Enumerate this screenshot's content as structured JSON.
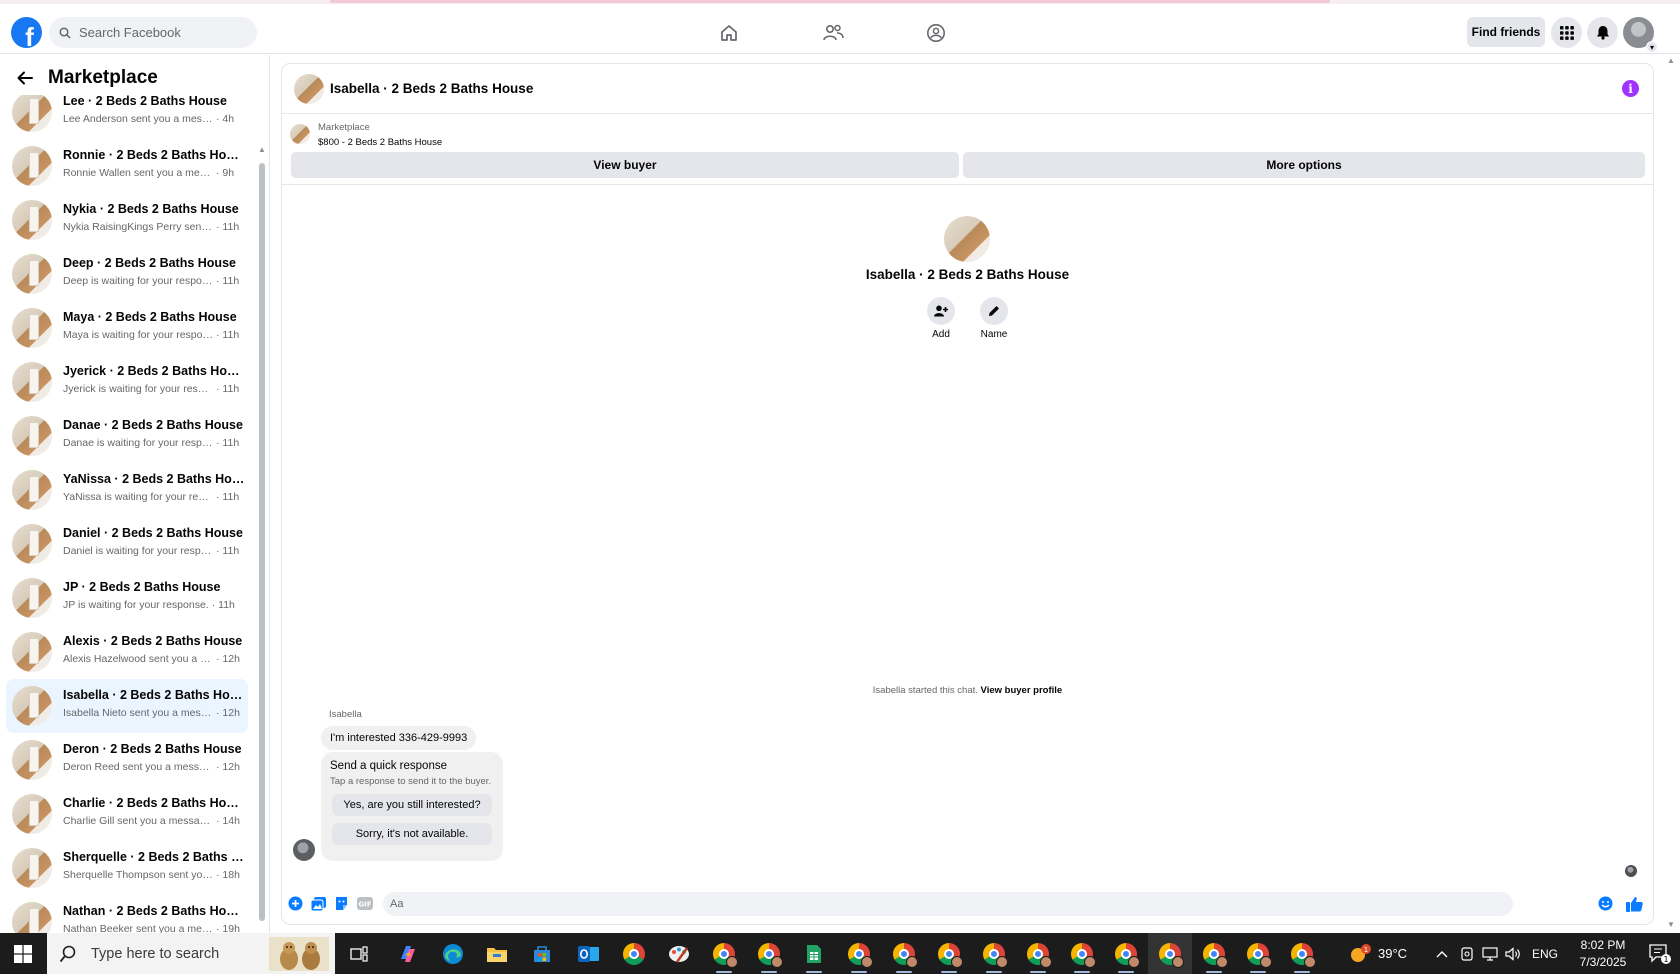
{
  "header": {
    "logo_letter": "f",
    "search_placeholder": "Search Facebook",
    "find_friends_label": "Find friends",
    "nav_icons": [
      "home-icon",
      "friends-icon",
      "groups-icon"
    ]
  },
  "sidebar": {
    "title": "Marketplace",
    "conversations": [
      {
        "name": "Lee · 2 Beds 2 Baths House",
        "preview": "Lee Anderson sent you a message ...",
        "time": "· 4h",
        "active": false
      },
      {
        "name": "Ronnie · 2 Beds 2 Baths House",
        "preview": "Ronnie Wallen sent you a message...",
        "time": "· 9h",
        "active": false
      },
      {
        "name": "Nykia · 2 Beds 2 Baths House",
        "preview": "Nykia RaisingKings Perry sent yo...",
        "time": "· 11h",
        "active": false
      },
      {
        "name": "Deep · 2 Beds 2 Baths House",
        "preview": "Deep is waiting for your response.",
        "time": "· 11h",
        "active": false
      },
      {
        "name": "Maya · 2 Beds 2 Baths House",
        "preview": "Maya is waiting for your response.",
        "time": "· 11h",
        "active": false
      },
      {
        "name": "Jyerick · 2 Beds 2 Baths House",
        "preview": "Jyerick is waiting for your respon...",
        "time": "· 11h",
        "active": false
      },
      {
        "name": "Danae · 2 Beds 2 Baths House",
        "preview": "Danae is waiting for your respon...",
        "time": "· 11h",
        "active": false
      },
      {
        "name": "YaNissa · 2 Beds 2 Baths House",
        "preview": "YaNissa is waiting for your respo...",
        "time": "· 11h",
        "active": false
      },
      {
        "name": "Daniel · 2 Beds 2 Baths House",
        "preview": "Daniel is waiting for your respon...",
        "time": "· 11h",
        "active": false
      },
      {
        "name": "JP · 2 Beds 2 Baths House",
        "preview": "JP is waiting for your response.",
        "time": "· 11h",
        "active": false
      },
      {
        "name": "Alexis · 2 Beds 2 Baths House",
        "preview": "Alexis Hazelwood sent you a mes...",
        "time": "· 12h",
        "active": false
      },
      {
        "name": "Isabella · 2 Beds 2 Baths House",
        "preview": "Isabella Nieto sent you a messag...",
        "time": "· 12h",
        "active": true
      },
      {
        "name": "Deron · 2 Beds 2 Baths House",
        "preview": "Deron Reed sent you a message ...",
        "time": "· 12h",
        "active": false
      },
      {
        "name": "Charlie · 2 Beds 2 Baths House",
        "preview": "Charlie Gill sent you a message a...",
        "time": "· 14h",
        "active": false
      },
      {
        "name": "Sherquelle · 2 Beds 2 Baths Hou...",
        "preview": "Sherquelle Thompson sent you a ...",
        "time": "· 18h",
        "active": false
      },
      {
        "name": "Nathan · 2 Beds 2 Baths House",
        "preview": "Nathan Beeker sent you a messa...",
        "time": "· 19h",
        "active": false
      }
    ]
  },
  "chat": {
    "title": "Isabella · 2 Beds 2 Baths House",
    "listing_source": "Marketplace",
    "listing_desc": "$800 - 2 Beds 2 Baths House",
    "view_buyer_label": "View buyer",
    "more_options_label": "More options",
    "intro_name": "Isabella · 2 Beds 2 Baths House",
    "add_label": "Add",
    "name_label": "Name",
    "started_text": "Isabella started this chat.",
    "view_buyer_profile_label": "View buyer profile",
    "sender": "Isabella",
    "message": "I'm interested 336-429-9993",
    "quick_title": "Send a quick response",
    "quick_sub": "Tap a response to send it to the buyer.",
    "quick_replies": [
      "Yes, are you still interested?",
      "Sorry, it's not available."
    ],
    "composer_placeholder": "Aa"
  },
  "taskbar": {
    "search_placeholder": "Type here to search",
    "temperature": "39°C",
    "language": "ENG",
    "time": "8:02 PM",
    "date": "7/3/2025",
    "notification_count": "1",
    "weather_badge": "1"
  },
  "colors": {
    "brand_blue": "#1877f2",
    "info_purple": "#a033ff",
    "active_row": "#ebf5ff",
    "taskbar": "#1c1c1c"
  }
}
